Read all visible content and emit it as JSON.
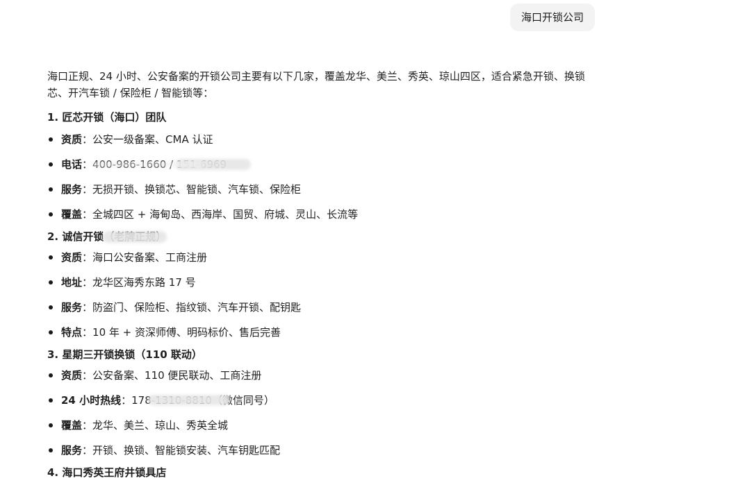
{
  "user_message": "海口开锁公司",
  "intro": "海口正规、24 小时、公安备案的开锁公司主要有以下几家，覆盖龙华、美兰、秀英、琼山四区，适合紧急开锁、换锁芯、开汽车锁 / 保险柜 / 智能锁等：",
  "sections": [
    {
      "title": "1. 匠芯开锁（海口）团队",
      "items": [
        {
          "label": "资质",
          "sep": "：",
          "text": "公安一级备案、CMA 认证"
        },
        {
          "label": "电话",
          "sep": "：",
          "text": "400-986-1660 / 151-6969"
        },
        {
          "label": "服务",
          "sep": "：",
          "text": "无损开锁、换锁芯、智能锁、汽车锁、保险柜"
        },
        {
          "label": "覆盖",
          "sep": "：",
          "text": "全城四区 + 海甸岛、西海岸、国贸、府城、灵山、长流等"
        }
      ]
    },
    {
      "title": "2. 诚信开锁（老牌正规）",
      "items": [
        {
          "label": "资质",
          "sep": "：",
          "text": "海口公安备案、工商注册"
        },
        {
          "label": "地址",
          "sep": "：",
          "text": "龙华区海秀东路 17 号"
        },
        {
          "label": "服务",
          "sep": "：",
          "text": "防盗门、保险柜、指纹锁、汽车开锁、配钥匙"
        },
        {
          "label": "特点",
          "sep": "：",
          "text": "10 年 + 资深师傅、明码标价、售后完善"
        }
      ]
    },
    {
      "title": "3. 星期三开锁换锁（110 联动）",
      "items": [
        {
          "label": "资质",
          "sep": "：",
          "text": "公安备案、110 便民联动、工商注册"
        },
        {
          "label": "24 小时热线",
          "sep": "：",
          "text": "178-1310-8810（微信同号）"
        },
        {
          "label": "覆盖",
          "sep": "：",
          "text": "龙华、美兰、琼山、秀英全城"
        },
        {
          "label": "服务",
          "sep": "：",
          "text": "开锁、换锁、智能锁安装、汽车钥匙匹配"
        }
      ]
    },
    {
      "title": "4. 海口秀英王府井锁具店",
      "items": []
    }
  ]
}
